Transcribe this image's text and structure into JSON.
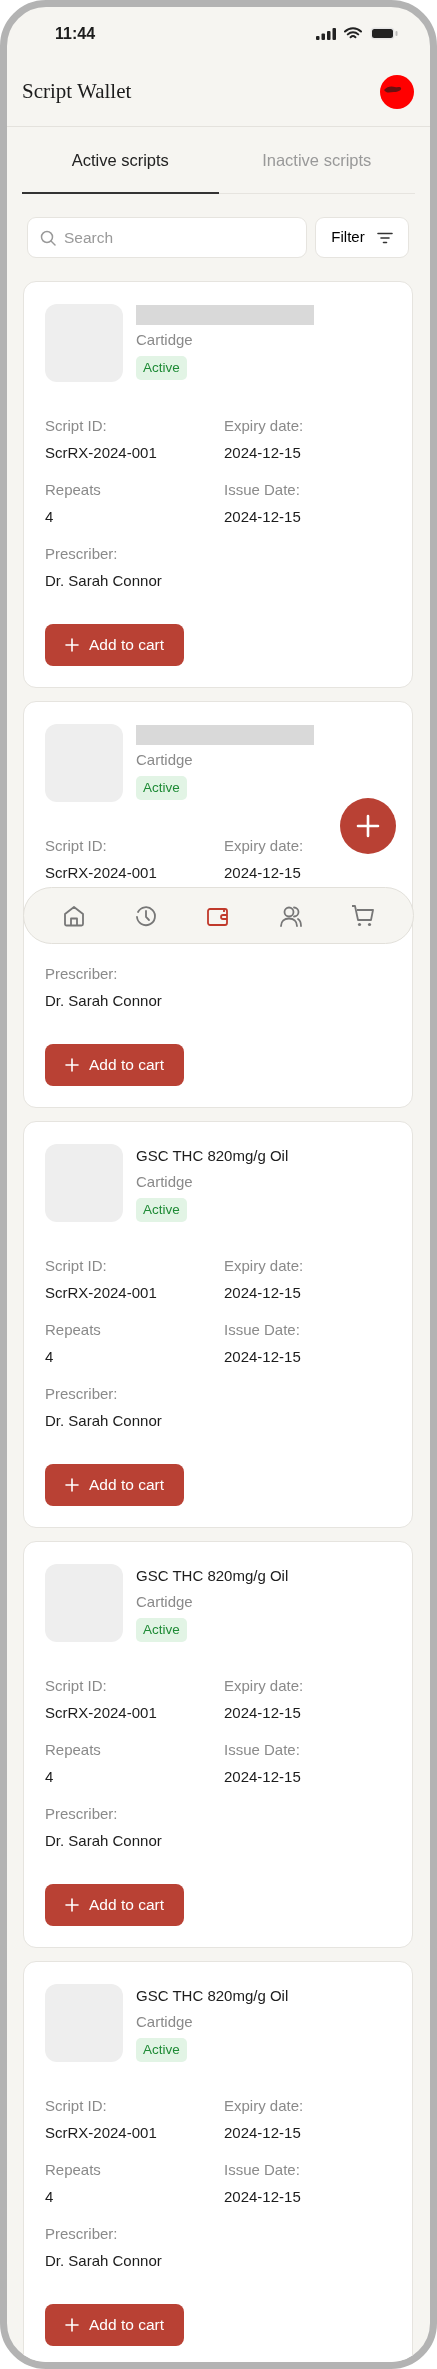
{
  "status_bar": {
    "time": "11:44"
  },
  "header": {
    "title": "Script Wallet"
  },
  "tabs": [
    {
      "label": "Active scripts",
      "selected": true
    },
    {
      "label": "Inactive scripts",
      "selected": false
    }
  ],
  "search": {
    "placeholder": "Search"
  },
  "filter": {
    "label": "Filter"
  },
  "scripts": [
    {
      "name_redacted": true,
      "type": "Cartidge",
      "status": "Active",
      "partly_covered": false,
      "fields": [
        {
          "label": "Script ID:",
          "value": "ScrRX-2024-001"
        },
        {
          "label": "Expiry date:",
          "value": "2024-12-15"
        },
        {
          "label": "Repeats",
          "value": "4"
        },
        {
          "label": "Issue Date:",
          "value": "2024-12-15"
        },
        {
          "label": "Prescriber:",
          "value": "Dr. Sarah Connor"
        }
      ],
      "button": "Add to cart"
    },
    {
      "name_redacted": true,
      "type": "Cartidge",
      "status": "Active",
      "partly_covered": true,
      "fields": [
        {
          "label": "Script ID:",
          "value": "ScrRX-2024-001"
        },
        {
          "label": "Expiry date:",
          "value": "2024-12-15"
        },
        {
          "label": "Prescriber:",
          "value": "Dr. Sarah Connor"
        }
      ],
      "button": "Add to cart"
    },
    {
      "name_redacted": false,
      "name": "GSC THC 820mg/g Oil",
      "type": "Cartidge",
      "status": "Active",
      "partly_covered": false,
      "fields": [
        {
          "label": "Script ID:",
          "value": "ScrRX-2024-001"
        },
        {
          "label": "Expiry date:",
          "value": "2024-12-15"
        },
        {
          "label": "Repeats",
          "value": "4"
        },
        {
          "label": "Issue Date:",
          "value": "2024-12-15"
        },
        {
          "label": "Prescriber:",
          "value": "Dr. Sarah Connor"
        }
      ],
      "button": "Add to cart"
    },
    {
      "name_redacted": false,
      "name": "GSC THC 820mg/g Oil",
      "type": "Cartidge",
      "status": "Active",
      "partly_covered": false,
      "fields": [
        {
          "label": "Script ID:",
          "value": "ScrRX-2024-001"
        },
        {
          "label": "Expiry date:",
          "value": "2024-12-15"
        },
        {
          "label": "Repeats",
          "value": "4"
        },
        {
          "label": "Issue Date:",
          "value": "2024-12-15"
        },
        {
          "label": "Prescriber:",
          "value": "Dr. Sarah Connor"
        }
      ],
      "button": "Add to cart"
    },
    {
      "name_redacted": false,
      "name": "GSC THC 820mg/g Oil",
      "type": "Cartidge",
      "status": "Active",
      "partly_covered": false,
      "fields": [
        {
          "label": "Script ID:",
          "value": "ScrRX-2024-001"
        },
        {
          "label": "Expiry date:",
          "value": "2024-12-15"
        },
        {
          "label": "Repeats",
          "value": "4"
        },
        {
          "label": "Issue Date:",
          "value": "2024-12-15"
        },
        {
          "label": "Prescriber:",
          "value": "Dr. Sarah Connor"
        }
      ],
      "button": "Add to cart"
    }
  ],
  "bottom_nav": [
    {
      "kind": "home",
      "selected": false
    },
    {
      "kind": "history",
      "selected": false
    },
    {
      "kind": "wallet",
      "selected": true
    },
    {
      "kind": "people",
      "selected": false
    },
    {
      "kind": "cart",
      "selected": false
    }
  ]
}
